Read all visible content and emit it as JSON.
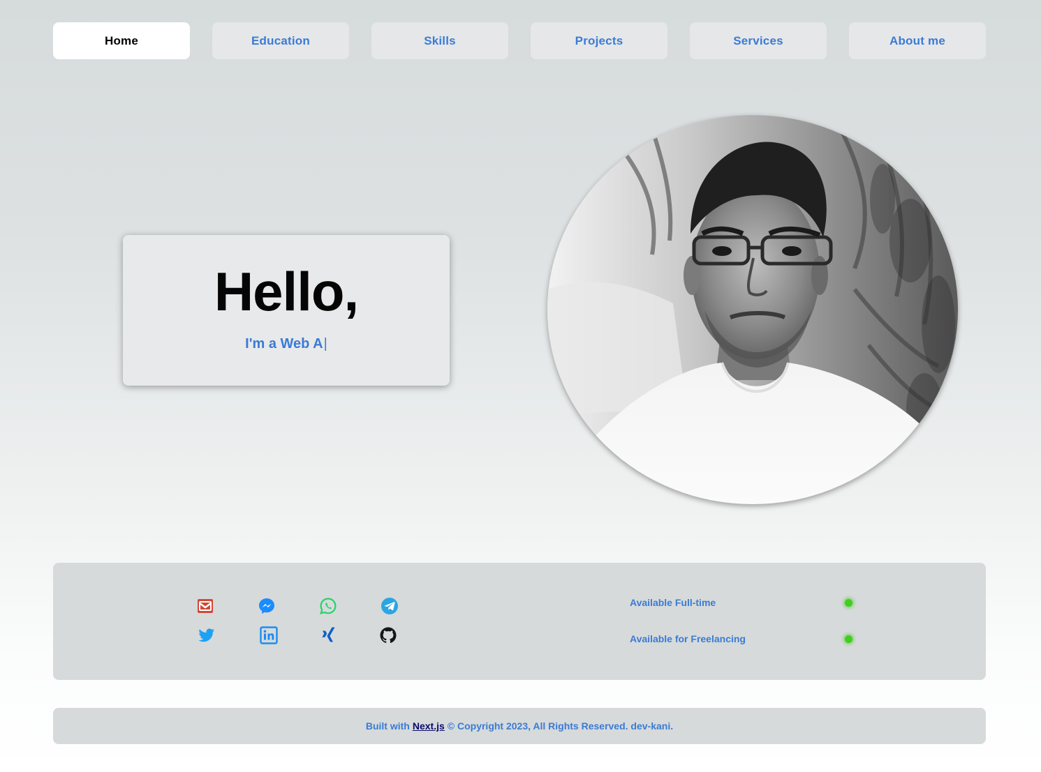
{
  "nav": {
    "tabs": [
      {
        "label": "Home",
        "active": true
      },
      {
        "label": "Education"
      },
      {
        "label": "Skills"
      },
      {
        "label": "Projects"
      },
      {
        "label": "Services"
      },
      {
        "label": "About me"
      }
    ]
  },
  "hero": {
    "title": "Hello,",
    "subtitle": "I'm a Web A",
    "cursor": "|"
  },
  "portrait": {
    "alt": "profile-photo"
  },
  "contact": {
    "icons": [
      {
        "name": "email-icon",
        "color": "#d14836"
      },
      {
        "name": "messenger-icon",
        "color": "#1a8cff"
      },
      {
        "name": "whatsapp-icon",
        "color": "#25d366"
      },
      {
        "name": "telegram-icon",
        "color": "#2ca5e0"
      },
      {
        "name": "twitter-icon",
        "color": "#1da1f2"
      },
      {
        "name": "linkedin-icon",
        "color": "#1d8cf0"
      },
      {
        "name": "xing-icon",
        "color": "#0d5ec9"
      },
      {
        "name": "github-icon",
        "color": "#161616"
      }
    ],
    "availability": [
      {
        "label": "Available Full-time",
        "status_color": "#3fcf1f"
      },
      {
        "label": "Available for Freelancing",
        "status_color": "#3fcf1f"
      }
    ]
  },
  "footer": {
    "prefix": "Built with",
    "link": "Next.js",
    "suffix": "© Copyright 2023, All Rights Reserved. dev-kani."
  },
  "colors": {
    "accent": "#3a7bd5",
    "panel": "#d6dadb",
    "active_tab": "#ffffff",
    "tab": "#e6e7e8"
  }
}
